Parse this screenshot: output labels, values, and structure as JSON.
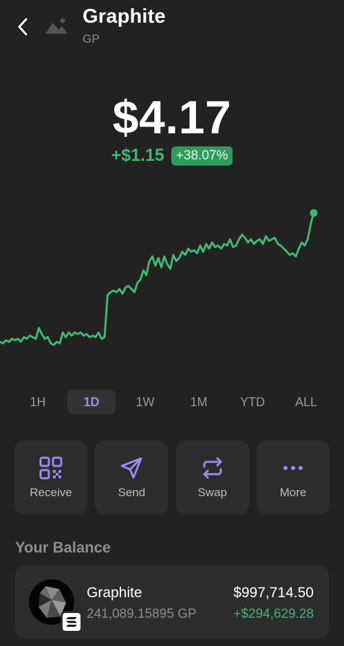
{
  "header": {
    "token_name": "Graphite",
    "token_symbol": "GP",
    "back_icon": "chevron-left-icon",
    "thumbnail_icon": "image-placeholder-icon"
  },
  "price": {
    "value": "$4.17",
    "change_abs": "+$1.15",
    "change_pct": "+38.07%"
  },
  "chart_data": {
    "type": "line",
    "color": "#3fb970",
    "ylim": [
      0,
      100
    ],
    "series": [
      {
        "values": [
          10,
          9,
          11,
          10,
          12,
          11,
          12,
          10,
          13,
          12,
          14,
          13,
          12,
          19,
          15,
          12,
          13,
          9,
          8,
          10,
          9,
          16,
          13,
          16,
          14,
          16,
          15,
          16,
          14,
          15,
          13,
          14,
          13,
          16,
          12,
          13,
          40,
          42,
          43,
          42,
          44,
          41,
          45,
          46,
          44,
          42,
          48,
          50,
          56,
          53,
          62,
          65,
          59,
          64,
          58,
          65,
          60,
          57,
          66,
          62,
          64,
          68,
          66,
          70,
          68,
          69,
          67,
          72,
          68,
          73,
          70,
          74,
          71,
          72,
          70,
          73,
          72,
          76,
          71,
          72,
          76,
          79,
          77,
          74,
          76,
          73,
          75,
          76,
          73,
          78,
          75,
          76,
          77,
          73,
          72,
          70,
          68,
          66,
          67,
          65,
          70,
          74,
          72,
          76,
          86,
          93
        ]
      }
    ]
  },
  "ranges": {
    "items": [
      "1H",
      "1D",
      "1W",
      "1M",
      "YTD",
      "ALL"
    ],
    "active": "1D"
  },
  "actions": {
    "receive": {
      "label": "Receive",
      "icon": "qr-code-icon"
    },
    "send": {
      "label": "Send",
      "icon": "send-arrow-icon"
    },
    "swap": {
      "label": "Swap",
      "icon": "swap-arrows-icon"
    },
    "more": {
      "label": "More",
      "icon": "more-dots-icon"
    }
  },
  "balance": {
    "title": "Your Balance",
    "coin_name": "Graphite",
    "coin_amount": "241,089.15895 GP",
    "coin_value": "$997,714.50",
    "coin_change": "+$294,629.28",
    "logo_icon": "graphite-logo-icon",
    "badge_icon": "solana-badge-icon"
  },
  "colors": {
    "background": "#222222",
    "card": "#2c2c2c",
    "positive": "#3fb970",
    "accent": "#9b8af5",
    "muted": "#8e8e8e"
  }
}
